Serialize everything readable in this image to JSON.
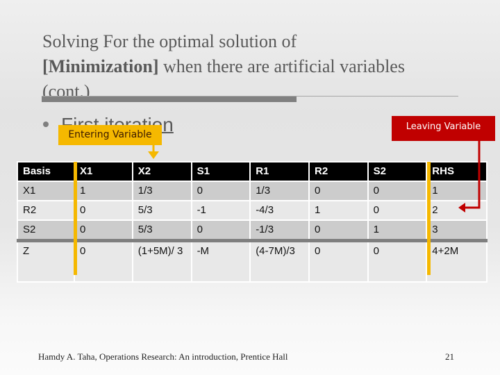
{
  "slide": {
    "title_line1": "Solving For the optimal solution of",
    "title_bold": "[Minimization]",
    "title_rest": " when there are artificial variables",
    "title_line3": "(cont.)",
    "bullet": "First iteration",
    "entering_label": "Entering Variable",
    "leaving_label": "Leaving Variable",
    "colors": {
      "entering": "#f5b800",
      "leaving": "#c00000",
      "header": "#000000"
    }
  },
  "table": {
    "headers": [
      "Basis",
      "X1",
      "X2",
      "S1",
      "R1",
      "R2",
      "S2",
      "RHS"
    ],
    "rows": [
      [
        "X1",
        "1",
        "1/3",
        "0",
        "1/3",
        "0",
        "0",
        "1"
      ],
      [
        "R2",
        "0",
        "5/3",
        "-1",
        "-4/3",
        "1",
        "0",
        "2"
      ],
      [
        "S2",
        "0",
        "5/3",
        "0",
        "-1/3",
        "0",
        "1",
        "3"
      ],
      [
        "Z",
        "0",
        "(1+5M)/ 3",
        "-M",
        "(4-7M)/3",
        "0",
        "0",
        "4+2M"
      ]
    ]
  },
  "footer": {
    "citation": "Hamdy A. Taha, Operations Research: An introduction, Prentice Hall",
    "page_number": "21"
  }
}
